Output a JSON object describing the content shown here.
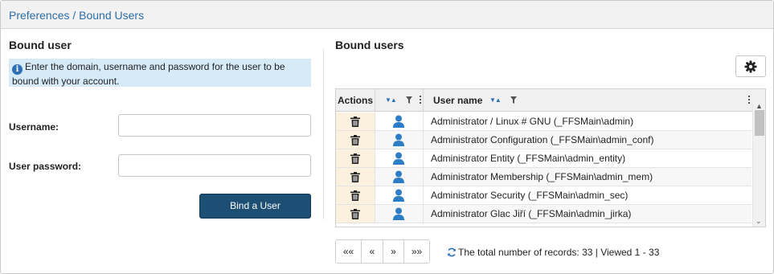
{
  "header": {
    "title": "Preferences / Bound Users"
  },
  "left": {
    "section_title": "Bound user",
    "info_text": "Enter the domain, username and password for the user to be bound with your account.",
    "username_label": "Username:",
    "username_value": "",
    "password_label": "User password:",
    "password_value": "",
    "bind_button": "Bind a User"
  },
  "right": {
    "section_title": "Bound users",
    "settings_icon": "gear-icon",
    "columns": {
      "actions": "Actions",
      "icon": "",
      "user_name": "User name"
    },
    "rows": [
      {
        "name": "Administrator / Linux # GNU (_FFSMain\\admin)"
      },
      {
        "name": "Administrator Configuration (_FFSMain\\admin_conf)"
      },
      {
        "name": "Administrator Entity (_FFSMain\\admin_entity)"
      },
      {
        "name": "Administrator Membership (_FFSMain\\admin_mem)"
      },
      {
        "name": "Administrator Security (_FFSMain\\admin_sec)"
      },
      {
        "name": "Administrator Glac Jiří (_FFSMain\\admin_jirka)"
      }
    ],
    "pager": {
      "first": "««",
      "prev": "«",
      "next": "»",
      "last": "»»"
    },
    "records_text": "The total number of records: 33 | Viewed 1 - 33"
  },
  "colors": {
    "title_blue": "#2b6ea6",
    "button_navy": "#1d4e74",
    "info_bg": "#d6eaf8",
    "actions_bg": "#fbf1de",
    "user_icon_blue": "#2d7dc6"
  }
}
